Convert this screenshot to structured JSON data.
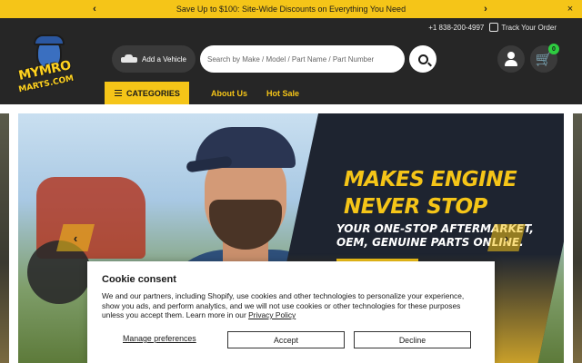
{
  "announcement": {
    "text": "Save Up to $100: Site-Wide Discounts on Everything You Need",
    "prev": "‹",
    "next": "›",
    "close": "×"
  },
  "utility": {
    "phone": "+1 838-200-4997",
    "track_label": "Track Your Order"
  },
  "logo": {
    "line1": "MYMRO",
    "line2": "MARTS.COM"
  },
  "header": {
    "add_vehicle_label": "Add a Vehicle",
    "search_placeholder": "Search by Make / Model / Part Name / Part Number",
    "cart_count": "0",
    "cart_icon": "cart-icon",
    "account_icon": "user-icon"
  },
  "nav": {
    "categories_label": "CATEGORIES",
    "links": [
      "About Us",
      "Hot Sale"
    ]
  },
  "hero": {
    "headline_line1": "MAKES ENGINE",
    "headline_line2": "NEVER STOP",
    "subhead_line1": "YOUR ONE-STOP AFTERMARKET,",
    "subhead_line2": "OEM, GENUINE PARTS ONLINE.",
    "prev": "‹",
    "next": "›"
  },
  "cookie": {
    "title": "Cookie consent",
    "body": "We and our partners, including Shopify, use cookies and other technologies to personalize your experience, show you ads, and perform analytics, and we will not use cookies or other technologies for these purposes unless you accept them. Learn more in our",
    "policy_link": "Privacy Policy",
    "manage_label": "Manage preferences",
    "accept_label": "Accept",
    "decline_label": "Decline"
  },
  "colors": {
    "accent_yellow": "#f5c518",
    "header_dark": "#262626",
    "cart_badge": "#2ecc40"
  }
}
